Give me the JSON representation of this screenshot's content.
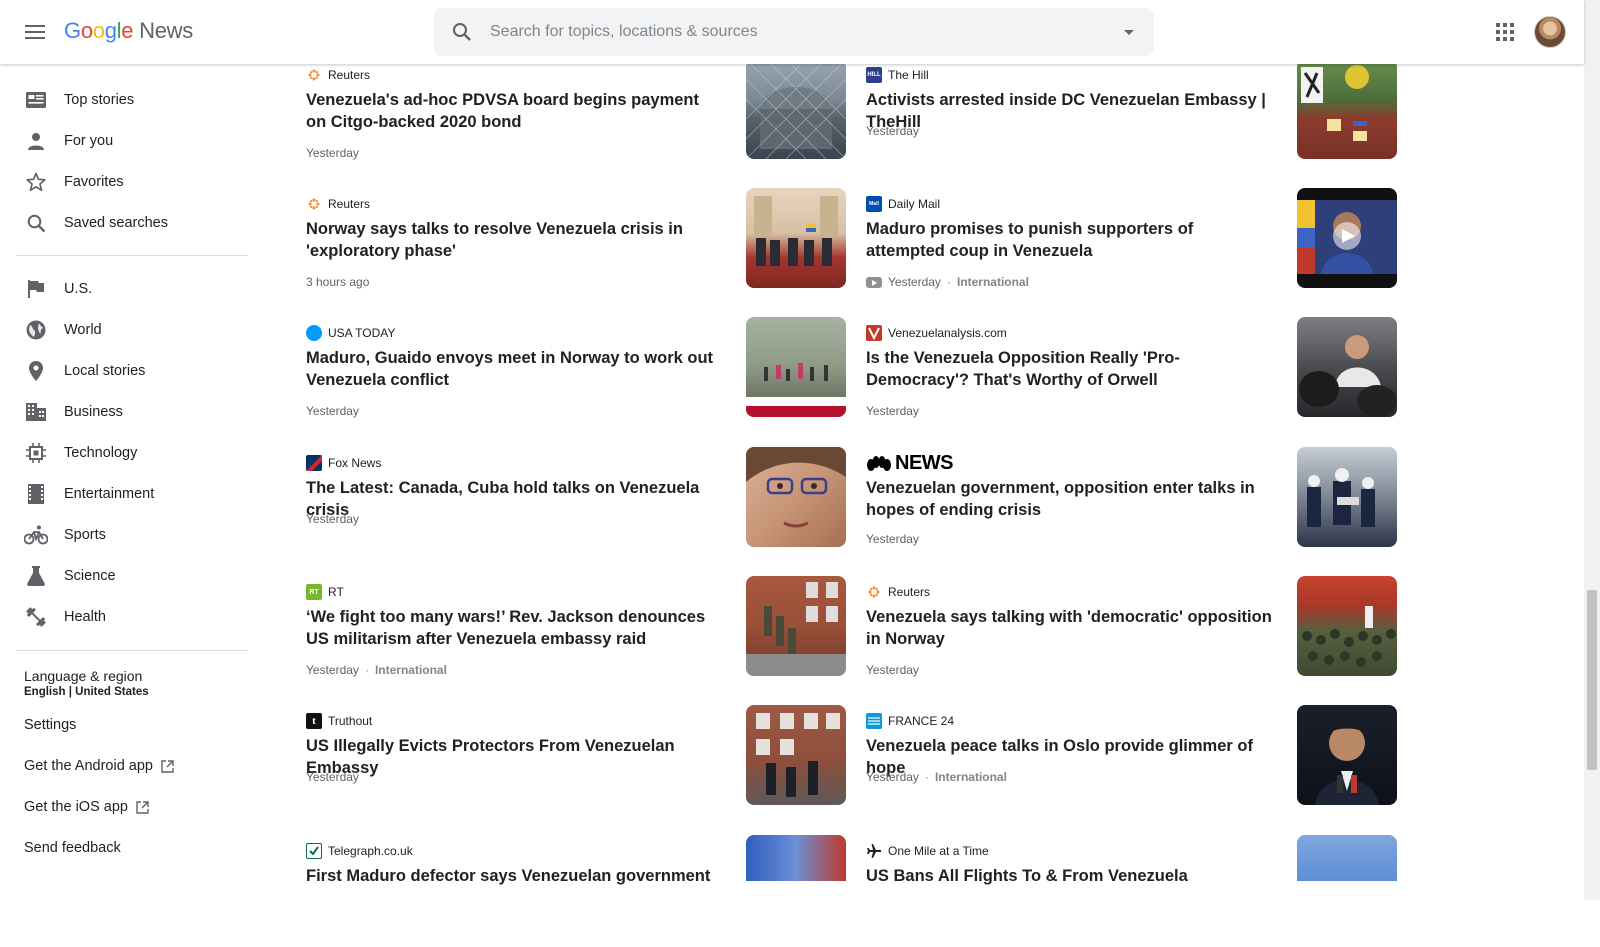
{
  "header": {
    "logo_parts": [
      "G",
      "o",
      "o",
      "g",
      "l",
      "e"
    ],
    "product": "News",
    "search_placeholder": "Search for topics, locations & sources"
  },
  "sidebar": {
    "primary": [
      {
        "label": "Top stories",
        "icon": "top-stories-icon"
      },
      {
        "label": "For you",
        "icon": "person-icon"
      },
      {
        "label": "Favorites",
        "icon": "star-icon"
      },
      {
        "label": "Saved searches",
        "icon": "search-icon"
      }
    ],
    "sections": [
      {
        "label": "U.S.",
        "icon": "flag-icon"
      },
      {
        "label": "World",
        "icon": "globe-icon"
      },
      {
        "label": "Local stories",
        "icon": "location-pin-icon"
      },
      {
        "label": "Business",
        "icon": "building-icon"
      },
      {
        "label": "Technology",
        "icon": "chip-icon"
      },
      {
        "label": "Entertainment",
        "icon": "film-icon"
      },
      {
        "label": "Sports",
        "icon": "bike-icon"
      },
      {
        "label": "Science",
        "icon": "flask-icon"
      },
      {
        "label": "Health",
        "icon": "dumbbell-icon"
      }
    ],
    "language_label": "Language & region",
    "language_value": "English | United States",
    "settings": "Settings",
    "android_app": "Get the Android app",
    "ios_app": "Get the iOS app",
    "feedback": "Send feedback"
  },
  "articles_left": [
    {
      "source": "Reuters",
      "source_icon": "reuters-icon",
      "title": "Venezuela's ad-hoc PDVSA board begins payment on Citgo-backed 2020 bond",
      "time": "Yesterday",
      "category": ""
    },
    {
      "source": "Reuters",
      "source_icon": "reuters-icon",
      "title": "Norway says talks to resolve Venezuela crisis in 'exploratory phase'",
      "time": "3 hours ago",
      "category": ""
    },
    {
      "source": "USA TODAY",
      "source_icon": "usa-today-icon",
      "title": "Maduro, Guaido envoys meet in Norway to work out Venezuela conflict",
      "time": "Yesterday",
      "category": ""
    },
    {
      "source": "Fox News",
      "source_icon": "fox-news-icon",
      "title": "The Latest: Canada, Cuba hold talks on Venezuela crisis",
      "time": "Yesterday",
      "category": ""
    },
    {
      "source": "RT",
      "source_icon": "rt-icon",
      "title": "‘We fight too many wars!’ Rev. Jackson denounces US militarism after Venezuela embassy raid",
      "time": "Yesterday",
      "category": "International"
    },
    {
      "source": "Truthout",
      "source_icon": "truthout-icon",
      "title": "US Illegally Evicts Protectors From Venezuelan Embassy",
      "time": "Yesterday",
      "category": ""
    },
    {
      "source": "Telegraph.co.uk",
      "source_icon": "telegraph-icon",
      "title": "First Maduro defector says Venezuelan government",
      "time": "",
      "category": ""
    }
  ],
  "articles_right": [
    {
      "source": "The Hill",
      "source_icon": "the-hill-icon",
      "title": "Activists arrested inside DC Venezuelan Embassy | TheHill",
      "time": "Yesterday",
      "category": ""
    },
    {
      "source": "Daily Mail",
      "source_icon": "daily-mail-icon",
      "title": "Maduro promises to punish supporters of attempted coup in Venezuela",
      "time": "Yesterday",
      "category": "International"
    },
    {
      "source": "Venezuelanalysis.com",
      "source_icon": "venezuelanalysis-icon",
      "title": "Is the Venezuela Opposition Really 'Pro-Democracy'? That's Worthy of Orwell",
      "time": "Yesterday",
      "category": ""
    },
    {
      "source": "NEWS",
      "source_icon": "nbc-news-icon",
      "title": "Venezuelan government, opposition enter talks in hopes of ending crisis",
      "time": "Yesterday",
      "category": ""
    },
    {
      "source": "Reuters",
      "source_icon": "reuters-icon",
      "title": "Venezuela says talking with 'democratic' opposition in Norway",
      "time": "Yesterday",
      "category": ""
    },
    {
      "source": "FRANCE 24",
      "source_icon": "france24-icon",
      "title": "Venezuela peace talks in Oslo provide glimmer of hope",
      "time": "Yesterday",
      "category": "International"
    },
    {
      "source": "One Mile at a Time",
      "source_icon": "plane-icon",
      "title": "US Bans All Flights To & From Venezuela",
      "time": "",
      "category": ""
    }
  ],
  "colors": {
    "text": "#202124",
    "muted": "#5f6368",
    "icon": "#5f6368",
    "search_bg": "#f1f3f4"
  }
}
